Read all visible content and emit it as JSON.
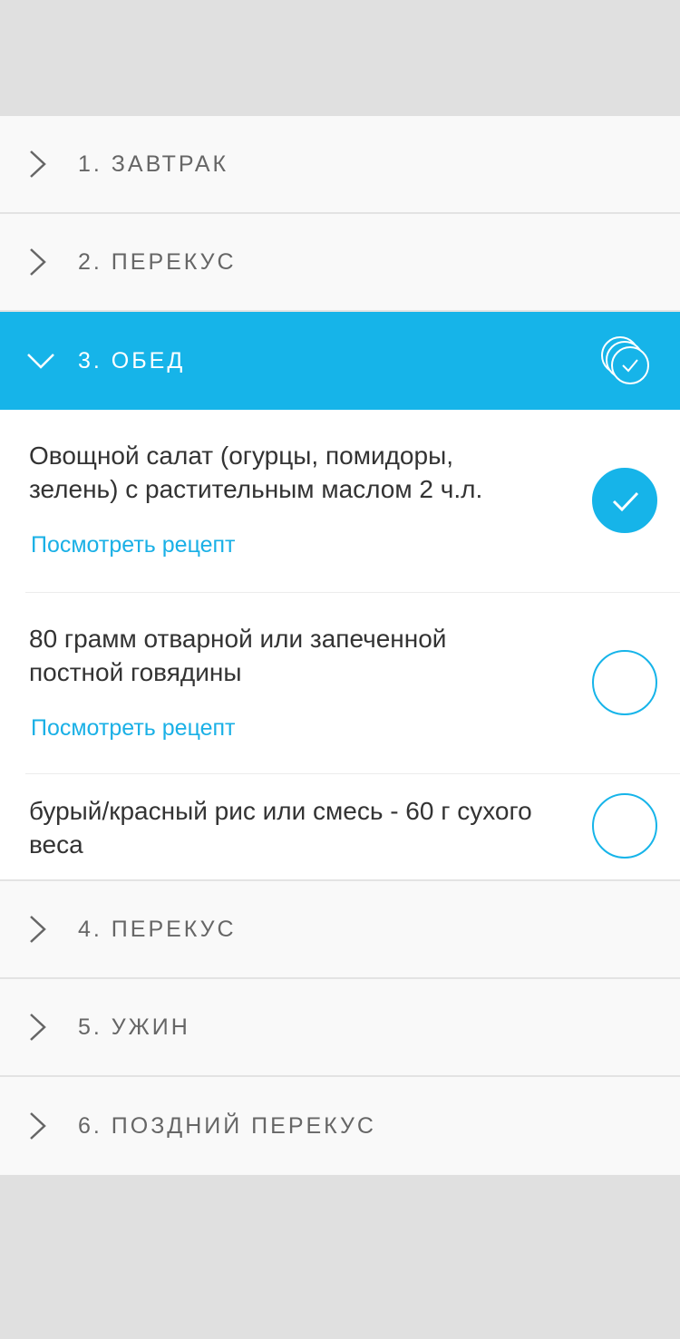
{
  "sections": [
    {
      "label": "1. ЗАВТРАК"
    },
    {
      "label": "2. ПЕРЕКУС"
    },
    {
      "label": "3. ОБЕД"
    },
    {
      "label": "4. ПЕРЕКУС"
    },
    {
      "label": "5. УЖИН"
    },
    {
      "label": "6. ПОЗДНИЙ ПЕРЕКУС"
    }
  ],
  "lunch_items": [
    {
      "text": "Овощной салат (огурцы, помидоры, зелень) с растительным маслом 2 ч.л.",
      "recipe_link": "Посмотреть рецепт",
      "checked": true
    },
    {
      "text": "80 грамм отварной или запеченной постной говядины",
      "recipe_link": "Посмотреть рецепт",
      "checked": false
    },
    {
      "text": "бурый/красный рис или смесь - 60 г сухого веса",
      "checked": false
    }
  ],
  "colors": {
    "accent": "#16b4e9",
    "background": "#e0e0e0",
    "section_bg": "#f9f9f9"
  },
  "icons": {
    "collapsed": "chevron-right-icon",
    "expanded": "chevron-down-icon",
    "mark_all": "multi-check-icon",
    "item_check": "check-icon"
  }
}
